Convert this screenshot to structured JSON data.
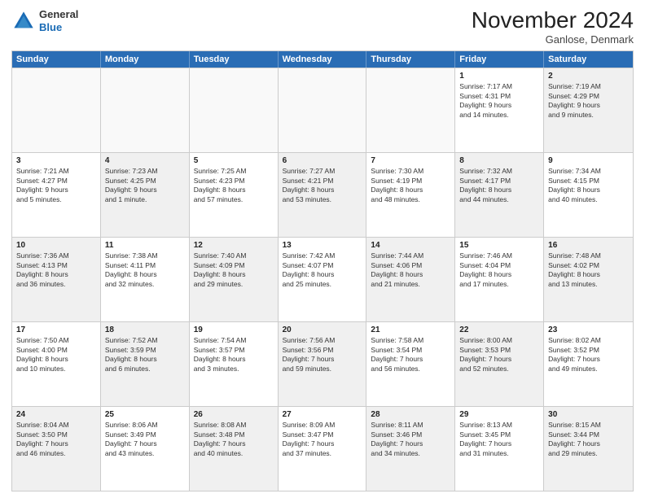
{
  "header": {
    "logo_line1": "General",
    "logo_line2": "Blue",
    "month": "November 2024",
    "location": "Ganlose, Denmark"
  },
  "days": [
    "Sunday",
    "Monday",
    "Tuesday",
    "Wednesday",
    "Thursday",
    "Friday",
    "Saturday"
  ],
  "rows": [
    [
      {
        "day": "",
        "empty": true
      },
      {
        "day": "",
        "empty": true
      },
      {
        "day": "",
        "empty": true
      },
      {
        "day": "",
        "empty": true
      },
      {
        "day": "",
        "empty": true
      },
      {
        "day": "1",
        "line1": "Sunrise: 7:17 AM",
        "line2": "Sunset: 4:31 PM",
        "line3": "Daylight: 9 hours",
        "line4": "and 14 minutes."
      },
      {
        "day": "2",
        "line1": "Sunrise: 7:19 AM",
        "line2": "Sunset: 4:29 PM",
        "line3": "Daylight: 9 hours",
        "line4": "and 9 minutes.",
        "shaded": true
      }
    ],
    [
      {
        "day": "3",
        "line1": "Sunrise: 7:21 AM",
        "line2": "Sunset: 4:27 PM",
        "line3": "Daylight: 9 hours",
        "line4": "and 5 minutes."
      },
      {
        "day": "4",
        "line1": "Sunrise: 7:23 AM",
        "line2": "Sunset: 4:25 PM",
        "line3": "Daylight: 9 hours",
        "line4": "and 1 minute.",
        "shaded": true
      },
      {
        "day": "5",
        "line1": "Sunrise: 7:25 AM",
        "line2": "Sunset: 4:23 PM",
        "line3": "Daylight: 8 hours",
        "line4": "and 57 minutes."
      },
      {
        "day": "6",
        "line1": "Sunrise: 7:27 AM",
        "line2": "Sunset: 4:21 PM",
        "line3": "Daylight: 8 hours",
        "line4": "and 53 minutes.",
        "shaded": true
      },
      {
        "day": "7",
        "line1": "Sunrise: 7:30 AM",
        "line2": "Sunset: 4:19 PM",
        "line3": "Daylight: 8 hours",
        "line4": "and 48 minutes."
      },
      {
        "day": "8",
        "line1": "Sunrise: 7:32 AM",
        "line2": "Sunset: 4:17 PM",
        "line3": "Daylight: 8 hours",
        "line4": "and 44 minutes.",
        "shaded": true
      },
      {
        "day": "9",
        "line1": "Sunrise: 7:34 AM",
        "line2": "Sunset: 4:15 PM",
        "line3": "Daylight: 8 hours",
        "line4": "and 40 minutes."
      }
    ],
    [
      {
        "day": "10",
        "line1": "Sunrise: 7:36 AM",
        "line2": "Sunset: 4:13 PM",
        "line3": "Daylight: 8 hours",
        "line4": "and 36 minutes.",
        "shaded": true
      },
      {
        "day": "11",
        "line1": "Sunrise: 7:38 AM",
        "line2": "Sunset: 4:11 PM",
        "line3": "Daylight: 8 hours",
        "line4": "and 32 minutes."
      },
      {
        "day": "12",
        "line1": "Sunrise: 7:40 AM",
        "line2": "Sunset: 4:09 PM",
        "line3": "Daylight: 8 hours",
        "line4": "and 29 minutes.",
        "shaded": true
      },
      {
        "day": "13",
        "line1": "Sunrise: 7:42 AM",
        "line2": "Sunset: 4:07 PM",
        "line3": "Daylight: 8 hours",
        "line4": "and 25 minutes."
      },
      {
        "day": "14",
        "line1": "Sunrise: 7:44 AM",
        "line2": "Sunset: 4:06 PM",
        "line3": "Daylight: 8 hours",
        "line4": "and 21 minutes.",
        "shaded": true
      },
      {
        "day": "15",
        "line1": "Sunrise: 7:46 AM",
        "line2": "Sunset: 4:04 PM",
        "line3": "Daylight: 8 hours",
        "line4": "and 17 minutes."
      },
      {
        "day": "16",
        "line1": "Sunrise: 7:48 AM",
        "line2": "Sunset: 4:02 PM",
        "line3": "Daylight: 8 hours",
        "line4": "and 13 minutes.",
        "shaded": true
      }
    ],
    [
      {
        "day": "17",
        "line1": "Sunrise: 7:50 AM",
        "line2": "Sunset: 4:00 PM",
        "line3": "Daylight: 8 hours",
        "line4": "and 10 minutes."
      },
      {
        "day": "18",
        "line1": "Sunrise: 7:52 AM",
        "line2": "Sunset: 3:59 PM",
        "line3": "Daylight: 8 hours",
        "line4": "and 6 minutes.",
        "shaded": true
      },
      {
        "day": "19",
        "line1": "Sunrise: 7:54 AM",
        "line2": "Sunset: 3:57 PM",
        "line3": "Daylight: 8 hours",
        "line4": "and 3 minutes."
      },
      {
        "day": "20",
        "line1": "Sunrise: 7:56 AM",
        "line2": "Sunset: 3:56 PM",
        "line3": "Daylight: 7 hours",
        "line4": "and 59 minutes.",
        "shaded": true
      },
      {
        "day": "21",
        "line1": "Sunrise: 7:58 AM",
        "line2": "Sunset: 3:54 PM",
        "line3": "Daylight: 7 hours",
        "line4": "and 56 minutes."
      },
      {
        "day": "22",
        "line1": "Sunrise: 8:00 AM",
        "line2": "Sunset: 3:53 PM",
        "line3": "Daylight: 7 hours",
        "line4": "and 52 minutes.",
        "shaded": true
      },
      {
        "day": "23",
        "line1": "Sunrise: 8:02 AM",
        "line2": "Sunset: 3:52 PM",
        "line3": "Daylight: 7 hours",
        "line4": "and 49 minutes."
      }
    ],
    [
      {
        "day": "24",
        "line1": "Sunrise: 8:04 AM",
        "line2": "Sunset: 3:50 PM",
        "line3": "Daylight: 7 hours",
        "line4": "and 46 minutes.",
        "shaded": true
      },
      {
        "day": "25",
        "line1": "Sunrise: 8:06 AM",
        "line2": "Sunset: 3:49 PM",
        "line3": "Daylight: 7 hours",
        "line4": "and 43 minutes."
      },
      {
        "day": "26",
        "line1": "Sunrise: 8:08 AM",
        "line2": "Sunset: 3:48 PM",
        "line3": "Daylight: 7 hours",
        "line4": "and 40 minutes.",
        "shaded": true
      },
      {
        "day": "27",
        "line1": "Sunrise: 8:09 AM",
        "line2": "Sunset: 3:47 PM",
        "line3": "Daylight: 7 hours",
        "line4": "and 37 minutes."
      },
      {
        "day": "28",
        "line1": "Sunrise: 8:11 AM",
        "line2": "Sunset: 3:46 PM",
        "line3": "Daylight: 7 hours",
        "line4": "and 34 minutes.",
        "shaded": true
      },
      {
        "day": "29",
        "line1": "Sunrise: 8:13 AM",
        "line2": "Sunset: 3:45 PM",
        "line3": "Daylight: 7 hours",
        "line4": "and 31 minutes."
      },
      {
        "day": "30",
        "line1": "Sunrise: 8:15 AM",
        "line2": "Sunset: 3:44 PM",
        "line3": "Daylight: 7 hours",
        "line4": "and 29 minutes.",
        "shaded": true
      }
    ]
  ]
}
